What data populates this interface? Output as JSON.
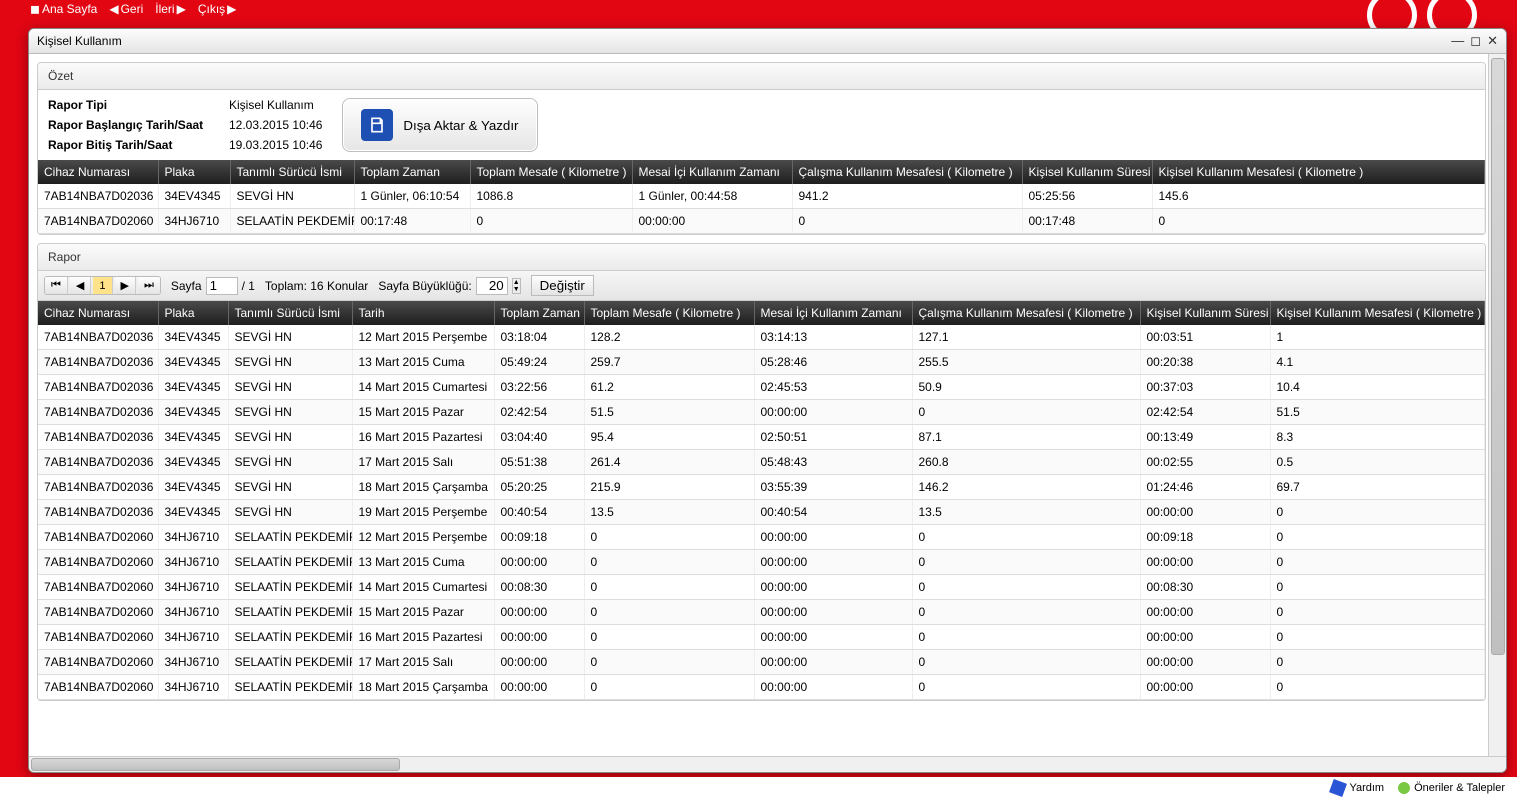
{
  "topnav": {
    "home": "Ana Sayfa",
    "back": "Geri",
    "forward": "İleri",
    "exit": "Çıkış"
  },
  "window": {
    "title": "Kişisel Kullanım"
  },
  "summary": {
    "panel_title": "Özet",
    "labels": {
      "report_type": "Rapor Tipi",
      "start": "Rapor Başlangıç Tarih/Saat",
      "end": "Rapor Bitiş Tarih/Saat"
    },
    "values": {
      "report_type": "Kişisel Kullanım",
      "start": "12.03.2015 10:46",
      "end": "19.03.2015 10:46"
    },
    "export_label": "Dışa Aktar & Yazdır"
  },
  "summary_table": {
    "headers": [
      "Cihaz Numarası",
      "Plaka",
      "Tanımlı Sürücü İsmi",
      "Toplam Zaman",
      "Toplam Mesafe ( Kilometre )",
      "Mesai İçi Kullanım Zamanı",
      "Çalışma Kullanım Mesafesi ( Kilometre )",
      "Kişisel Kullanım Süresi",
      "Kişisel Kullanım Mesafesi ( Kilometre )"
    ],
    "rows": [
      [
        "7AB14NBA7D02036",
        "34EV4345",
        "SEVGİ HN",
        "1 Günler, 06:10:54",
        "1086.8",
        "1 Günler, 00:44:58",
        "941.2",
        "05:25:56",
        "145.6"
      ],
      [
        "7AB14NBA7D02060",
        "34HJ6710",
        "SELAATİN PEKDEMİR",
        "00:17:48",
        "0",
        "00:00:00",
        "0",
        "00:17:48",
        "0"
      ]
    ]
  },
  "report": {
    "panel_title": "Rapor",
    "pager": {
      "page_label": "Sayfa",
      "page_value": "1",
      "page_total": "/ 1",
      "total_text": "Toplam: 16 Konular",
      "size_label": "Sayfa Büyüklüğü:",
      "size_value": "20",
      "change_btn": "Değiştir"
    },
    "table": {
      "headers": [
        "Cihaz Numarası",
        "Plaka",
        "Tanımlı Sürücü İsmi",
        "Tarih",
        "Toplam Zaman",
        "Toplam Mesafe ( Kilometre )",
        "Mesai İçi Kullanım Zamanı",
        "Çalışma Kullanım Mesafesi ( Kilometre )",
        "Kişisel Kullanım Süresi",
        "Kişisel Kullanım Mesafesi ( Kilometre )"
      ],
      "rows": [
        [
          "7AB14NBA7D02036",
          "34EV4345",
          "SEVGİ HN",
          "12 Mart 2015 Perşembe",
          "03:18:04",
          "128.2",
          "03:14:13",
          "127.1",
          "00:03:51",
          "1"
        ],
        [
          "7AB14NBA7D02036",
          "34EV4345",
          "SEVGİ HN",
          "13 Mart 2015 Cuma",
          "05:49:24",
          "259.7",
          "05:28:46",
          "255.5",
          "00:20:38",
          "4.1"
        ],
        [
          "7AB14NBA7D02036",
          "34EV4345",
          "SEVGİ HN",
          "14 Mart 2015 Cumartesi",
          "03:22:56",
          "61.2",
          "02:45:53",
          "50.9",
          "00:37:03",
          "10.4"
        ],
        [
          "7AB14NBA7D02036",
          "34EV4345",
          "SEVGİ HN",
          "15 Mart 2015 Pazar",
          "02:42:54",
          "51.5",
          "00:00:00",
          "0",
          "02:42:54",
          "51.5"
        ],
        [
          "7AB14NBA7D02036",
          "34EV4345",
          "SEVGİ HN",
          "16 Mart 2015 Pazartesi",
          "03:04:40",
          "95.4",
          "02:50:51",
          "87.1",
          "00:13:49",
          "8.3"
        ],
        [
          "7AB14NBA7D02036",
          "34EV4345",
          "SEVGİ HN",
          "17 Mart 2015 Salı",
          "05:51:38",
          "261.4",
          "05:48:43",
          "260.8",
          "00:02:55",
          "0.5"
        ],
        [
          "7AB14NBA7D02036",
          "34EV4345",
          "SEVGİ HN",
          "18 Mart 2015 Çarşamba",
          "05:20:25",
          "215.9",
          "03:55:39",
          "146.2",
          "01:24:46",
          "69.7"
        ],
        [
          "7AB14NBA7D02036",
          "34EV4345",
          "SEVGİ HN",
          "19 Mart 2015 Perşembe",
          "00:40:54",
          "13.5",
          "00:40:54",
          "13.5",
          "00:00:00",
          "0"
        ],
        [
          "7AB14NBA7D02060",
          "34HJ6710",
          "SELAATİN PEKDEMİR",
          "12 Mart 2015 Perşembe",
          "00:09:18",
          "0",
          "00:00:00",
          "0",
          "00:09:18",
          "0"
        ],
        [
          "7AB14NBA7D02060",
          "34HJ6710",
          "SELAATİN PEKDEMİR",
          "13 Mart 2015 Cuma",
          "00:00:00",
          "0",
          "00:00:00",
          "0",
          "00:00:00",
          "0"
        ],
        [
          "7AB14NBA7D02060",
          "34HJ6710",
          "SELAATİN PEKDEMİR",
          "14 Mart 2015 Cumartesi",
          "00:08:30",
          "0",
          "00:00:00",
          "0",
          "00:08:30",
          "0"
        ],
        [
          "7AB14NBA7D02060",
          "34HJ6710",
          "SELAATİN PEKDEMİR",
          "15 Mart 2015 Pazar",
          "00:00:00",
          "0",
          "00:00:00",
          "0",
          "00:00:00",
          "0"
        ],
        [
          "7AB14NBA7D02060",
          "34HJ6710",
          "SELAATİN PEKDEMİR",
          "16 Mart 2015 Pazartesi",
          "00:00:00",
          "0",
          "00:00:00",
          "0",
          "00:00:00",
          "0"
        ],
        [
          "7AB14NBA7D02060",
          "34HJ6710",
          "SELAATİN PEKDEMİR",
          "17 Mart 2015 Salı",
          "00:00:00",
          "0",
          "00:00:00",
          "0",
          "00:00:00",
          "0"
        ],
        [
          "7AB14NBA7D02060",
          "34HJ6710",
          "SELAATİN PEKDEMİR",
          "18 Mart 2015 Çarşamba",
          "00:00:00",
          "0",
          "00:00:00",
          "0",
          "00:00:00",
          "0"
        ]
      ]
    }
  },
  "footer": {
    "help": "Yardım",
    "suggestions": "Öneriler & Talepler"
  }
}
